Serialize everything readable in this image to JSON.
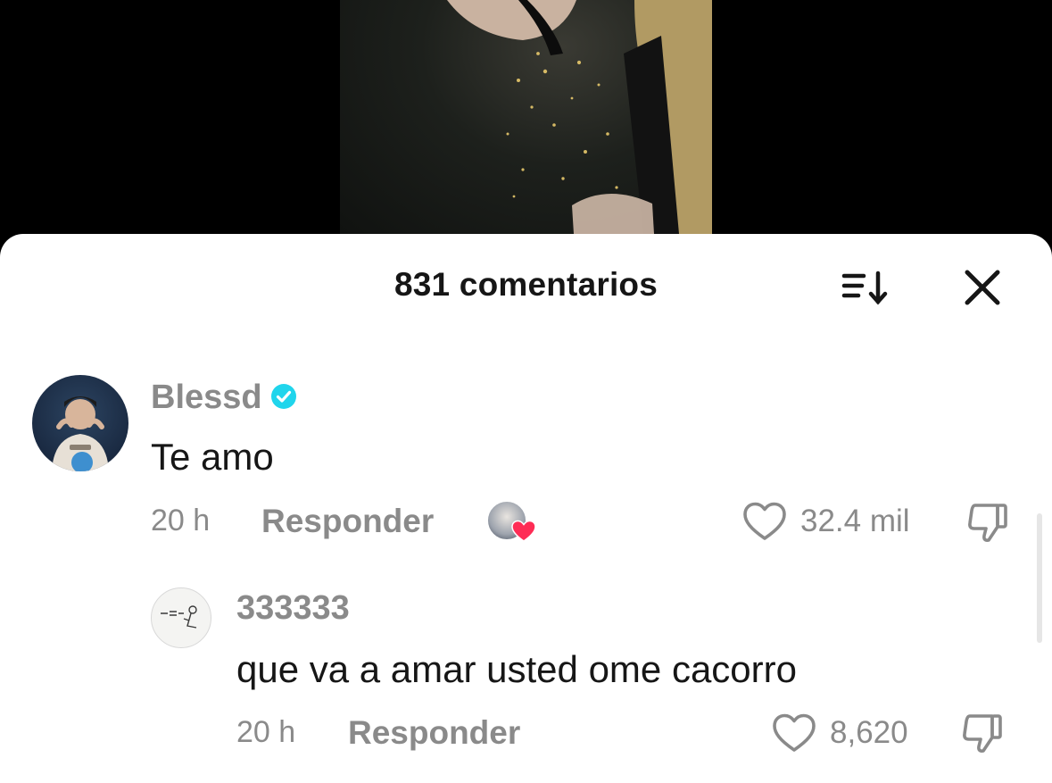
{
  "header": {
    "title": "831 comentarios",
    "sort_icon": "sort-icon",
    "close_icon": "close-icon"
  },
  "comments": [
    {
      "username": "Blessd",
      "verified": true,
      "text": "Te amo",
      "time": "20 h",
      "reply_label": "Responder",
      "creator_liked": true,
      "likes": "32.4 mil"
    },
    {
      "username": "333333",
      "verified": false,
      "text": "que va a amar usted ome cacorro",
      "time": "20 h",
      "reply_label": "Responder",
      "likes": "8,620"
    }
  ],
  "colors": {
    "verified": "#20d5ec",
    "creator_heart": "#fe2c55",
    "muted_text": "#8a8a8a"
  }
}
